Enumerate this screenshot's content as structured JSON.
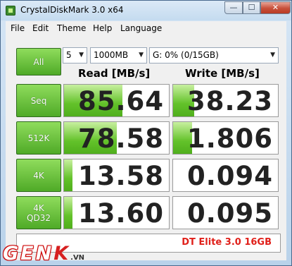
{
  "window": {
    "title": "CrystalDiskMark 3.0 x64"
  },
  "window_buttons": {
    "minimize": "—",
    "maximize": "☐",
    "close": "✕"
  },
  "menu": [
    "File",
    "Edit",
    "Theme",
    "Help",
    "Language"
  ],
  "controls": {
    "all_label": "All",
    "count": "5",
    "size": "1000MB",
    "drive": "G: 0% (0/15GB)",
    "dropdown_glyph": "▼"
  },
  "headers": {
    "read": "Read [MB/s]",
    "write": "Write [MB/s]"
  },
  "rows": [
    {
      "label": "Seq",
      "read": "85.64",
      "write": "38.23",
      "read_fill": 0.56,
      "write_fill": 0.2
    },
    {
      "label": "512K",
      "read": "78.58",
      "write": "1.806",
      "read_fill": 0.5,
      "write_fill": 0.18
    },
    {
      "label": "4K",
      "read": "13.58",
      "write": "0.094",
      "read_fill": 0.08,
      "write_fill": 0
    },
    {
      "label": "4K\nQD32",
      "read": "13.60",
      "write": "0.095",
      "read_fill": 0.08,
      "write_fill": 0
    }
  ],
  "comment": "DT Elite 3.0 16GB",
  "watermark": {
    "gen": "GEN",
    "k": "K",
    "suffix": ".VN"
  }
}
